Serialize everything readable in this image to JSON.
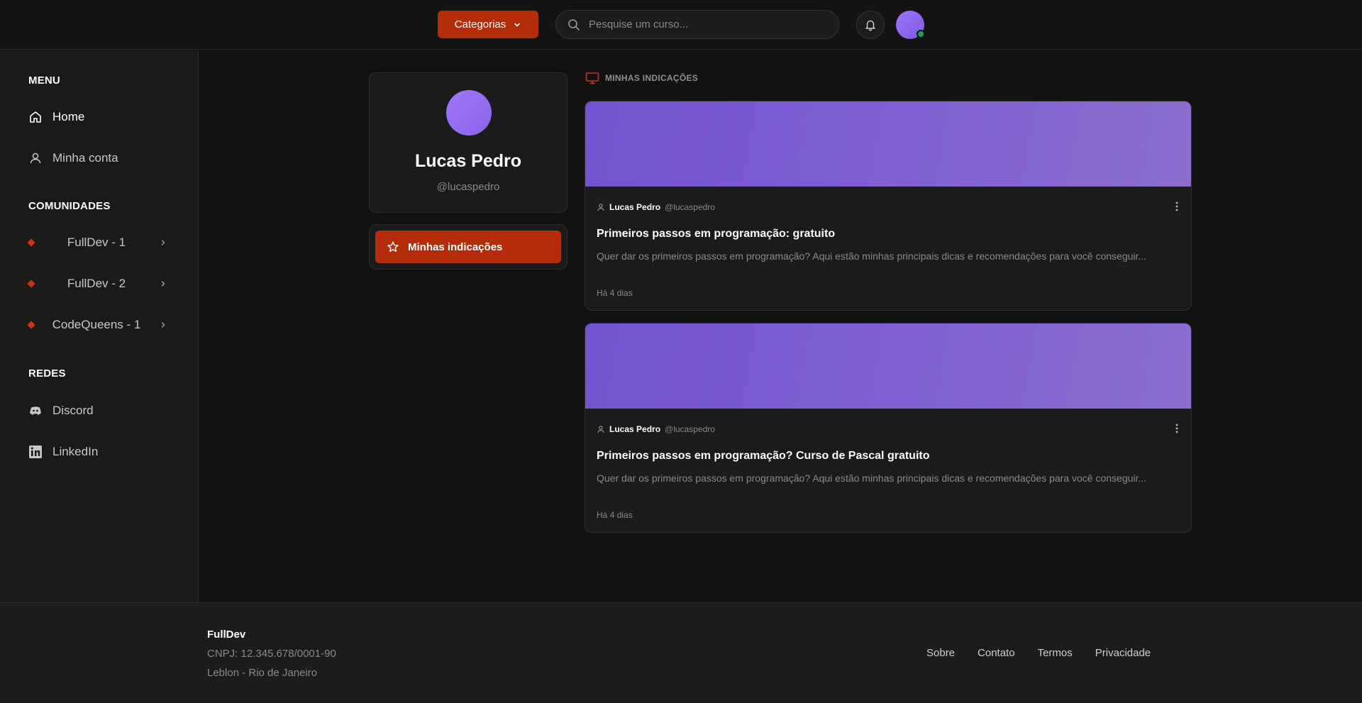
{
  "header": {
    "categories_label": "Categorias",
    "search_placeholder": "Pesquise um curso..."
  },
  "sidebar": {
    "menu_title": "MENU",
    "menu_items": [
      {
        "label": "Home",
        "icon": "home-icon"
      },
      {
        "label": "Minha conta",
        "icon": "user-icon"
      }
    ],
    "communities_title": "COMUNIDADES",
    "communities": [
      {
        "label": "FullDev - 1"
      },
      {
        "label": "FullDev - 2"
      },
      {
        "label": "CodeQueens - 1"
      }
    ],
    "networks_title": "REDES",
    "networks": [
      {
        "label": "Discord",
        "icon": "discord-icon"
      },
      {
        "label": "LinkedIn",
        "icon": "linkedin-icon"
      }
    ]
  },
  "profile": {
    "name": "Lucas Pedro",
    "handle": "@lucaspedro",
    "menu_active": "Minhas indicações"
  },
  "main": {
    "section_title": "MINHAS INDICAÇÕES",
    "posts": [
      {
        "author": "Lucas Pedro",
        "handle": "@lucaspedro",
        "title": "Primeiros passos em programação: gratuito",
        "description": "Quer dar os primeiros passos em programação? Aqui estão minhas principais dicas e recomendações para você conseguir...",
        "time": "Há 4 dias"
      },
      {
        "author": "Lucas Pedro",
        "handle": "@lucaspedro",
        "title": "Primeiros passos em programação? Curso de Pascal gratuito",
        "description": "Quer dar os primeiros passos em programação? Aqui estão minhas principais dicas e recomendações para você conseguir...",
        "time": "Há 4 dias"
      }
    ]
  },
  "footer": {
    "brand": "FullDev",
    "cnpj": "CNPJ: 12.345.678/0001-90",
    "address": "Leblon - Rio de Janeiro",
    "links": [
      "Sobre",
      "Contato",
      "Termos",
      "Privacidade"
    ]
  },
  "colors": {
    "accent": "#b52c0a",
    "avatar": "#9b74f5",
    "online": "#1e9e5a",
    "banner": "#7f5fd2"
  }
}
